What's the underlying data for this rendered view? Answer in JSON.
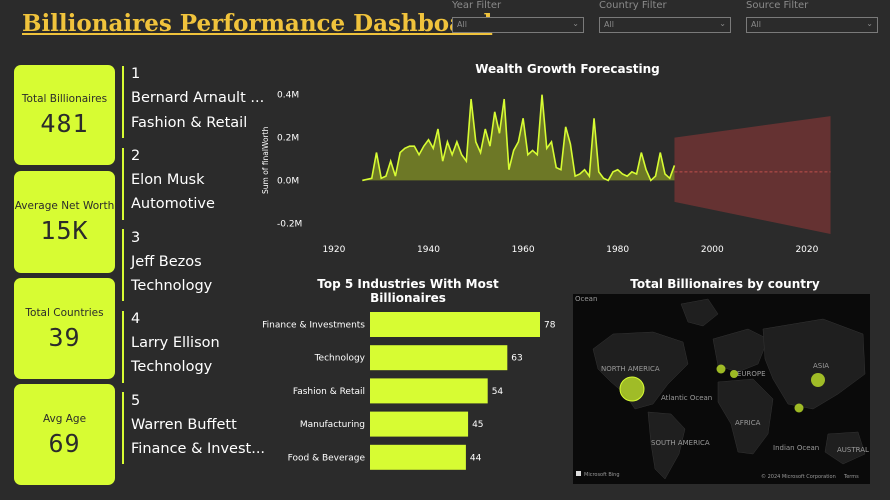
{
  "header": {
    "title": "Billionaires Performance Dashboard"
  },
  "filters": [
    {
      "label": "Year Filter",
      "value": "All"
    },
    {
      "label": "Country Filter",
      "value": "All"
    },
    {
      "label": "Source Filter",
      "value": "All"
    }
  ],
  "kpis": [
    {
      "label": "Total Billionaires",
      "value": "481"
    },
    {
      "label": "Average Net Worth",
      "value": "15K"
    },
    {
      "label": "Total Countries",
      "value": "39"
    },
    {
      "label": "Avg Age",
      "value": "69"
    }
  ],
  "rankings": [
    {
      "rank": "1",
      "name": "Bernard Arnault ...",
      "industry": "Fashion & Retail"
    },
    {
      "rank": "2",
      "name": "Elon Musk",
      "industry": "Automotive"
    },
    {
      "rank": "3",
      "name": "Jeff Bezos",
      "industry": "Technology"
    },
    {
      "rank": "4",
      "name": "Larry Ellison",
      "industry": "Technology"
    },
    {
      "rank": "5",
      "name": "Warren Buffett",
      "industry": "Finance & Invest..."
    }
  ],
  "colors": {
    "accent": "#d7fc33",
    "title": "#f0c33c",
    "background": "#2b2b2b",
    "forecast": "#7a3535"
  },
  "chart_data": [
    {
      "type": "area",
      "title": "Wealth Growth Forecasting",
      "ylabel": "Sum of finalWorth",
      "xlabel": "",
      "xlim": [
        1916,
        2027
      ],
      "ylim": [
        -0.25,
        0.45
      ],
      "x_ticks": [
        "1920",
        "1940",
        "1960",
        "1980",
        "2000",
        "2020"
      ],
      "y_ticks": [
        "0.4M",
        "0.2M",
        "0.0M",
        "-0.2M"
      ],
      "series": [
        {
          "x": [
            1926,
            1928,
            1929,
            1930,
            1931,
            1932,
            1933,
            1934,
            1935,
            1936,
            1937,
            1938,
            1939,
            1940,
            1941,
            1942,
            1943,
            1944,
            1945,
            1946,
            1947,
            1948,
            1949,
            1950,
            1951,
            1952,
            1953,
            1954,
            1955,
            1956,
            1957,
            1958,
            1959,
            1960,
            1961,
            1962,
            1963,
            1964,
            1965,
            1966,
            1967,
            1968,
            1969,
            1970,
            1971,
            1972,
            1973,
            1974,
            1975,
            1976,
            1977,
            1978,
            1979,
            1980,
            1981,
            1982,
            1983,
            1984,
            1985,
            1986,
            1987,
            1988,
            1989,
            1990,
            1991,
            1992
          ],
          "y": [
            0.0,
            0.01,
            0.13,
            0.01,
            0.02,
            0.09,
            0.02,
            0.13,
            0.15,
            0.16,
            0.16,
            0.12,
            0.16,
            0.19,
            0.15,
            0.24,
            0.09,
            0.18,
            0.12,
            0.18,
            0.12,
            0.09,
            0.38,
            0.18,
            0.13,
            0.24,
            0.16,
            0.32,
            0.22,
            0.38,
            0.05,
            0.14,
            0.18,
            0.29,
            0.12,
            0.14,
            0.12,
            0.4,
            0.15,
            0.18,
            0.06,
            0.05,
            0.25,
            0.17,
            0.02,
            0.03,
            0.05,
            0.02,
            0.29,
            0.04,
            0.01,
            0.0,
            0.04,
            0.05,
            0.03,
            0.02,
            0.04,
            0.03,
            0.13,
            0.05,
            0.0,
            0.02,
            0.13,
            0.03,
            0.01,
            0.07
          ]
        }
      ],
      "forecast": {
        "x_start": 1992,
        "x_end": 2025,
        "center": 0.04,
        "upper_start": 0.2,
        "upper_end": 0.3,
        "lower_start": -0.1,
        "lower_end": -0.25
      }
    },
    {
      "type": "bar",
      "title": "Top 5 Industries With Most Billionaires",
      "categories": [
        "Finance & Investments",
        "Technology",
        "Fashion & Retail",
        "Manufacturing",
        "Food & Beverage"
      ],
      "values": [
        78,
        63,
        54,
        45,
        44
      ],
      "xlim": [
        0,
        78
      ]
    }
  ],
  "map": {
    "title": "Total Billionaires by country",
    "labels": [
      "NORTH AMERICA",
      "EUROPE",
      "ASIA",
      "AFRICA",
      "SOUTH AMERICA",
      "Atlantic Ocean",
      "Indian Ocean",
      "Ocean",
      "AUSTRAL"
    ],
    "credits": {
      "brand": "Microsoft Bing",
      "copyright": "© 2024 Microsoft Corporation",
      "terms": "Terms"
    },
    "bubbles": [
      {
        "region": "United States",
        "size": "large"
      },
      {
        "region": "United Kingdom",
        "size": "small"
      },
      {
        "region": "France",
        "size": "small"
      },
      {
        "region": "China",
        "size": "medium"
      },
      {
        "region": "India",
        "size": "small"
      }
    ]
  }
}
